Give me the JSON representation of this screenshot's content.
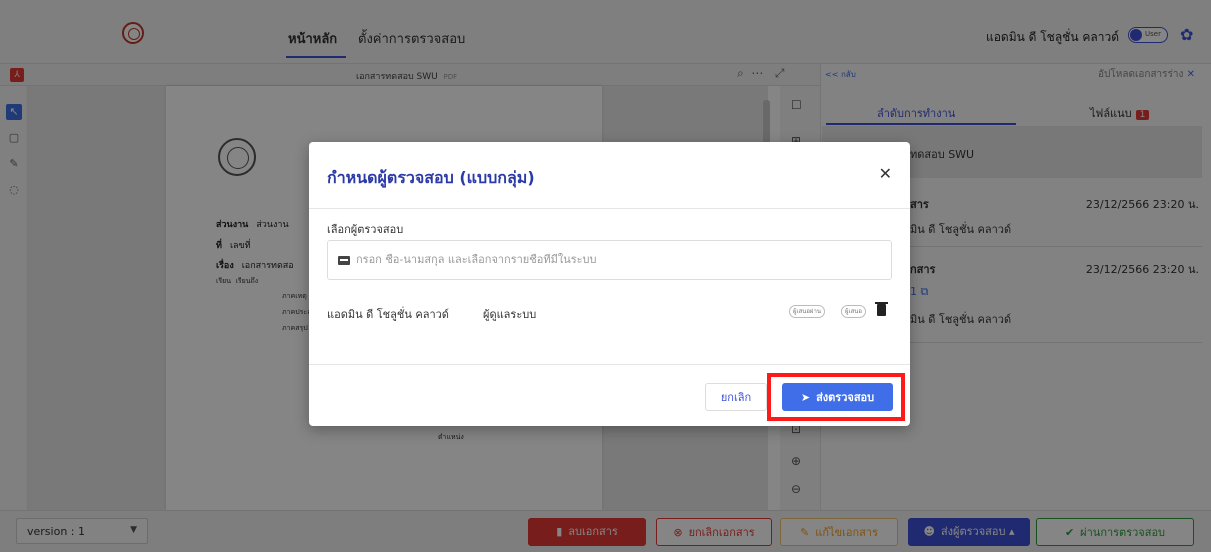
{
  "nav": {
    "tabs": [
      {
        "label": "หน้าหลัก"
      },
      {
        "label": "ตั้งค่าการตรวจสอบ"
      }
    ],
    "user_name": "แอดมิน ดี โชลูชั่น คลาวด์",
    "toggle_label": "User"
  },
  "doc": {
    "title": "เอกสารทดสอบ SWU",
    "title_suffix": "PDF",
    "lines": {
      "unit_label": "ส่วนงาน",
      "unit_value": "ส่วนงาน",
      "no_label": "ที่",
      "no_value": "เลขที่",
      "subject_label": "เรื่อง",
      "subject_value": "เอกสารทดสอ",
      "to_label": "เรียน",
      "to_value": "เรียนถึง",
      "p1": "ภาคเหตุ",
      "p2": "ภาคประส",
      "p3": "ภาคสรุป",
      "position": "ตำแหน่ง"
    }
  },
  "right_panel": {
    "back_label": "<< กลับ",
    "draft_label": "อัปโหลดเอกสารร่าง",
    "tabs": [
      {
        "label": "ลำดับการทำงาน"
      },
      {
        "label": "ไฟล์แนบ",
        "badge": "1"
      }
    ],
    "items": [
      {
        "title": "ทดสอบ SWU"
      },
      {
        "title": "สาร",
        "timestamp": "23/12/2566 23:20 น.",
        "user": "มิน ดี โชลูชั่น คลาวด์"
      },
      {
        "title": "กสาร",
        "timestamp": "23/12/2566 23:20 น.",
        "link_text": "1",
        "user": "มิน ดี โชลูชั่น คลาวด์"
      }
    ]
  },
  "modal": {
    "title": "กำหนดผู้ตรวจสอบ (แบบกลุ่ม)",
    "field_label": "เลือกผู้ตรวจสอบ",
    "search_placeholder": "กรอก ชื่อ-นามสกุล และเลือกจากรายชื่อที่มีในระบบ",
    "reviewer": {
      "name": "แอดมิน ดี โชลูชั่น คลาวด์",
      "role": "ผู้ดูแลระบบ",
      "chips": [
        "ผู้เสนอผ่าน",
        "ผู้เสนอ"
      ]
    },
    "cancel_label": "ยกเลิก",
    "submit_label": "ส่งตรวจสอบ"
  },
  "footer": {
    "version_label": "version : 1",
    "buttons": {
      "delete": "ลบเอกสาร",
      "cancel_doc": "ยกเลิกเอกสาร",
      "edit": "แก้ไขเอกสาร",
      "send_reviewer": "ส่งผู้ตรวจสอบ",
      "pass": "ผ่านการตรวจสอบ"
    }
  },
  "colors": {
    "primary": "#3f51d6",
    "danger": "#e53935",
    "success": "#2e9b3f",
    "warning": "#f29d1e",
    "highlight": "#ff1a1a"
  }
}
